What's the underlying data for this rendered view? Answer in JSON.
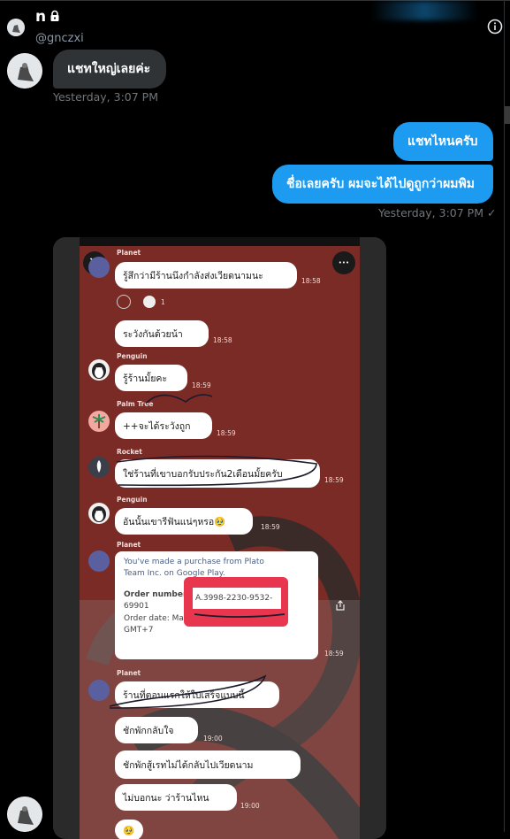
{
  "header": {
    "name": "n",
    "lock_icon": "lock-icon",
    "handle": "@gnczxi",
    "info_icon": "info-icon"
  },
  "messages": {
    "m1": "แชทใหญ่เลยค่ะ",
    "t1": "Yesterday, 3:07 PM",
    "m2": "แชทไหนครับ",
    "m3": "ชื่อเลยครับ ผมจะได้ไปดูถูกว่าผมพิม",
    "t2": "Yesterday, 3:07 PM",
    "check": "✓"
  },
  "screenshot": {
    "close": "×",
    "more": "•••",
    "r1_user": "Planet",
    "r1_text": "รู้สึกว่ามีร้านนึงกำลังส่งเวียดนามนะ",
    "r1_time": "18:58",
    "react_count": "1",
    "r2_text": "ระวังกันด้วยน้า",
    "r2_time": "18:58",
    "r3_user": "Penguin",
    "r3_text": "รู้ร้านมั้ยคะ",
    "r3_time": "18:59",
    "r4_user": "Palm Tree",
    "r4_text": "++จะได้ระวังถูก",
    "r4_time": "18:59",
    "r5_user": "Rocket",
    "r5_text": "ใช่ร้านที่เขาบอกรับประกัน2เดือนมั้ยครับ",
    "r5_time": "18:59",
    "r6_user": "Penguin",
    "r6_text": "อันนั้นเขารีฟันแน่ๆหรอ🥹",
    "r6_time": "18:59",
    "r7_user": "Planet",
    "card_line1": "You've made a purchase from Plato",
    "card_line2": "Team Inc. on Google Play.",
    "card_order_label": "Order number:",
    "card_order_value": "A.3998-2230-9532-",
    "card_order_value2": "69901",
    "card_date": "Order date: May 2, 2022 16:20:22 PM",
    "card_gmt": "GMT+7",
    "r7_time": "18:59",
    "r8_user": "Planet",
    "r8_text": "ร้านที่ตอนแรกให้ใบเสร็จแบบนี้",
    "r9_text": "ชักพักกลับใจ",
    "r9_time": "19:00",
    "r10_text": "ชักพักสู้เรทไม่ได้กลับไปเวียดนาม",
    "r11_text": "ไม่บอกนะ ว่าร้านไหน",
    "r11_time": "19:00",
    "r12_text": "🥹"
  }
}
